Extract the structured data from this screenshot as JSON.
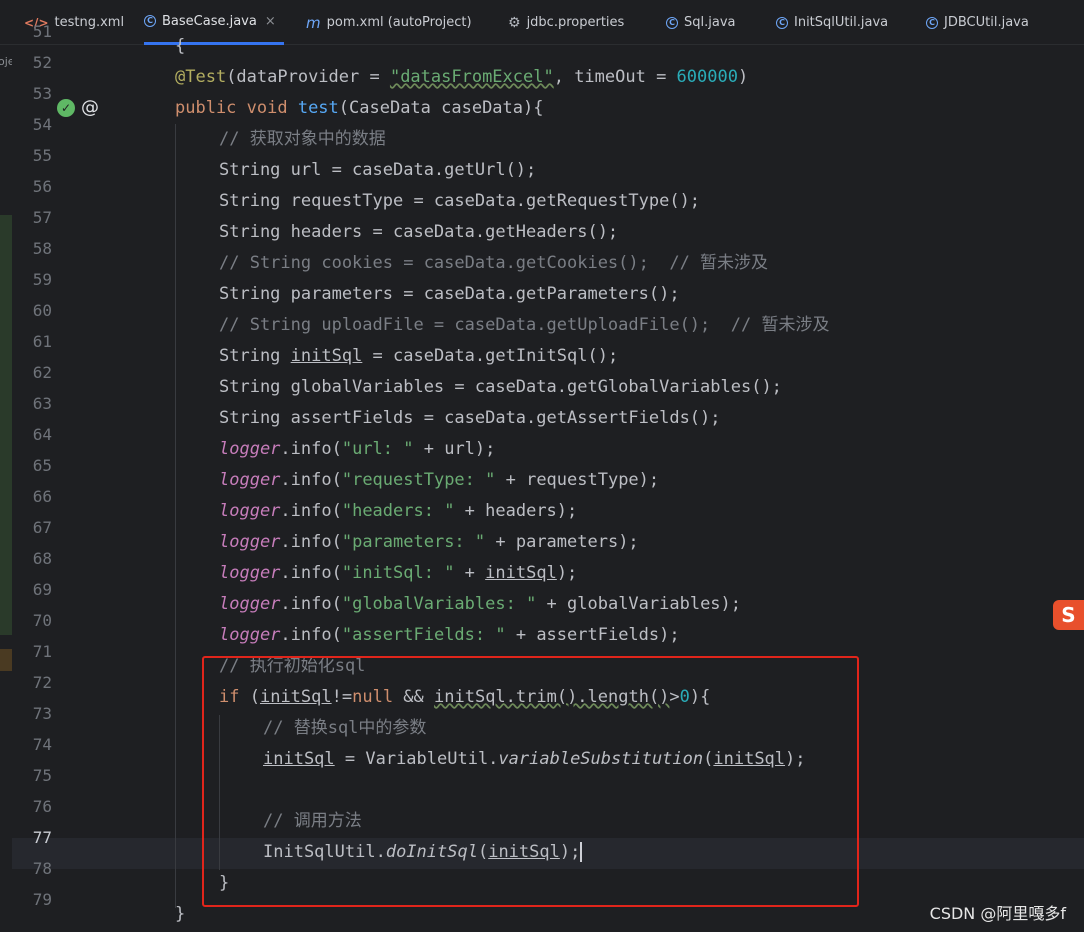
{
  "tabs": [
    {
      "label": "testng.xml",
      "icon": "xml-file-icon"
    },
    {
      "label": "BaseCase.java",
      "icon": "java-class-icon",
      "active": true,
      "close": "×"
    },
    {
      "label": "pom.xml (autoProject)",
      "icon": "maven-icon"
    },
    {
      "label": "jdbc.properties",
      "icon": "gear-icon"
    },
    {
      "label": "Sql.java",
      "icon": "java-class-icon"
    },
    {
      "label": "InitSqlUtil.java",
      "icon": "java-class-icon"
    },
    {
      "label": "JDBCUtil.java",
      "icon": "java-class-icon"
    }
  ],
  "sidebar_label": "oje",
  "editor": {
    "current_line": "77",
    "lines": [
      {
        "n": "51"
      },
      {
        "n": "52"
      },
      {
        "n": "53"
      },
      {
        "n": "54"
      },
      {
        "n": "55"
      },
      {
        "n": "56"
      },
      {
        "n": "57"
      },
      {
        "n": "58"
      },
      {
        "n": "59"
      },
      {
        "n": "60"
      },
      {
        "n": "61"
      },
      {
        "n": "62"
      },
      {
        "n": "63"
      },
      {
        "n": "64"
      },
      {
        "n": "65"
      },
      {
        "n": "66"
      },
      {
        "n": "67"
      },
      {
        "n": "68"
      },
      {
        "n": "69"
      },
      {
        "n": "70"
      },
      {
        "n": "71"
      },
      {
        "n": "72"
      },
      {
        "n": "73"
      },
      {
        "n": "74"
      },
      {
        "n": "75"
      },
      {
        "n": "76"
      },
      {
        "n": "77"
      },
      {
        "n": "78"
      },
      {
        "n": "79"
      }
    ],
    "code": {
      "l52_ann": "@Test",
      "l52_a": "(dataProvider = ",
      "l52_str": "\"datasFromExcel\"",
      "l52_b": ", timeOut = ",
      "l52_num": "600000",
      "l52_c": ")",
      "l53_kw": "public void ",
      "l53_fn": "test",
      "l53_rest": "(CaseData caseData){",
      "l54": "// 获取对象中的数据",
      "l55": "String url = caseData.getUrl();",
      "l56": "String requestType = caseData.getRequestType();",
      "l57": "String headers = caseData.getHeaders();",
      "l58": "// String cookies = caseData.getCookies();  // 暂未涉及",
      "l59": "String parameters = caseData.getParameters();",
      "l60": "// String uploadFile = caseData.getUploadFile();  // 暂未涉及",
      "l61_a": "String ",
      "l61_var": "initSql",
      "l61_b": " = caseData.getInitSql();",
      "l62": "String globalVariables = caseData.getGlobalVariables();",
      "l63": "String assertFields = caseData.getAssertFields();",
      "logger": "logger",
      "info": ".info(",
      "l64_str": "\"url: \"",
      "l64_rest": " + url);",
      "l65_str": "\"requestType: \"",
      "l65_rest": " + requestType);",
      "l66_str": "\"headers: \"",
      "l66_rest": " + headers);",
      "l67_str": "\"parameters: \"",
      "l67_rest": " + parameters);",
      "l68_str": "\"initSql: \"",
      "l68_a": " + ",
      "l68_var": "initSql",
      "l68_b": ");",
      "l69_str": "\"globalVariables: \"",
      "l69_rest": " + globalVariables);",
      "l70_str": "\"assertFields: \"",
      "l70_rest": " + assertFields);",
      "l71": "// 执行初始化sql",
      "l72_if": "if",
      "l72_a": " (",
      "l72_var": "initSql",
      "l72_b": "!=",
      "l72_null": "null",
      "l72_c": " && ",
      "l72_d": "initSql.trim().length()",
      "l72_e": ">",
      "l72_zero": "0",
      "l72_f": "){",
      "l73": "// 替换sql中的参数",
      "l74_var": "initSql",
      "l74_a": " = VariableUtil.",
      "l74_fn": "variableSubstitution",
      "l74_b": "(",
      "l74_c": ");",
      "l76": "// 调用方法",
      "l77_a": "InitSqlUtil.",
      "l77_fn": "doInitSql",
      "l77_b": "(",
      "l77_var": "initSql",
      "l77_c": ");",
      "l78": "}",
      "l79": "}"
    }
  },
  "watermark": "CSDN @阿里嘎多f",
  "accent_color": "#3574f0",
  "highlight_color": "#e1251b"
}
